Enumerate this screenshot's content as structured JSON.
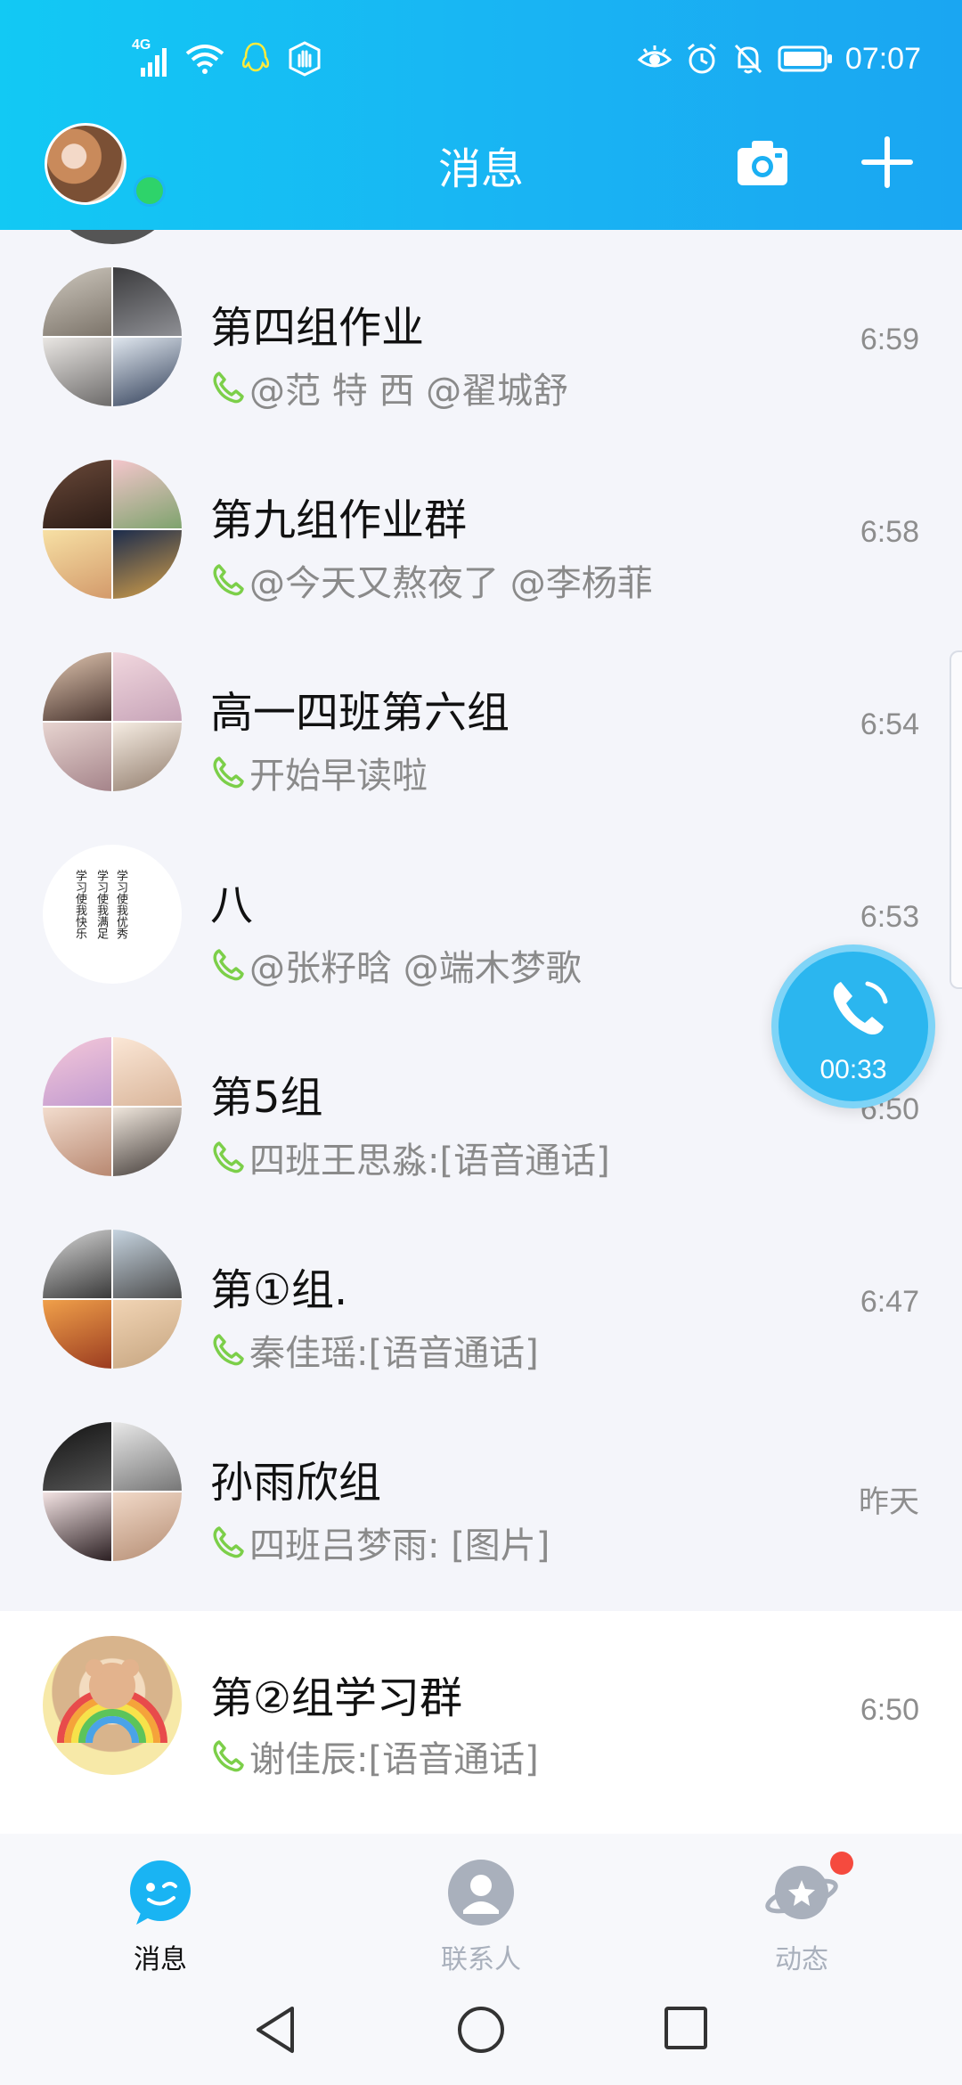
{
  "status_bar": {
    "network": "4G",
    "time": "07:07"
  },
  "header": {
    "title": "消息"
  },
  "conversations": [
    {
      "name": "第四组作业",
      "preview": "@范 特 西  @翟城舒",
      "time": "6:59"
    },
    {
      "name": "第九组作业群",
      "preview": "@今天又熬夜了 @李杨菲",
      "time": "6:58"
    },
    {
      "name": "高一四班第六组",
      "preview": "开始早读啦",
      "time": "6:54"
    },
    {
      "name": "八",
      "preview": "@张籽晗 @端木梦歌",
      "time": "6:53"
    },
    {
      "name": "第5组",
      "preview": "四班王思淼:[语音通话]",
      "time": "6:50"
    },
    {
      "name": "第①组.",
      "preview": "秦佳瑶:[语音通话]",
      "time": "6:47"
    },
    {
      "name": "孙雨欣组",
      "preview": "四班吕梦雨: [图片]",
      "time": "昨天"
    },
    {
      "name": "第②组学习群",
      "preview": "谢佳辰:[语音通话]",
      "time": "6:50"
    }
  ],
  "avatar_text": {
    "line1": "学习使我快乐",
    "line2": "学习使我满足",
    "line3": "学习使我优秀"
  },
  "call_floating": {
    "duration": "00:33"
  },
  "tabs": [
    {
      "label": "消息",
      "active": true
    },
    {
      "label": "联系人",
      "active": false
    },
    {
      "label": "动态",
      "active": false
    }
  ],
  "colors": {
    "header_start": "#12c9f4",
    "header_end": "#1aa6f2",
    "active_tab": "#111111",
    "inactive_tab": "#a9b0bc",
    "badge": "#f54a3e",
    "call_green": "#7ccf49"
  }
}
